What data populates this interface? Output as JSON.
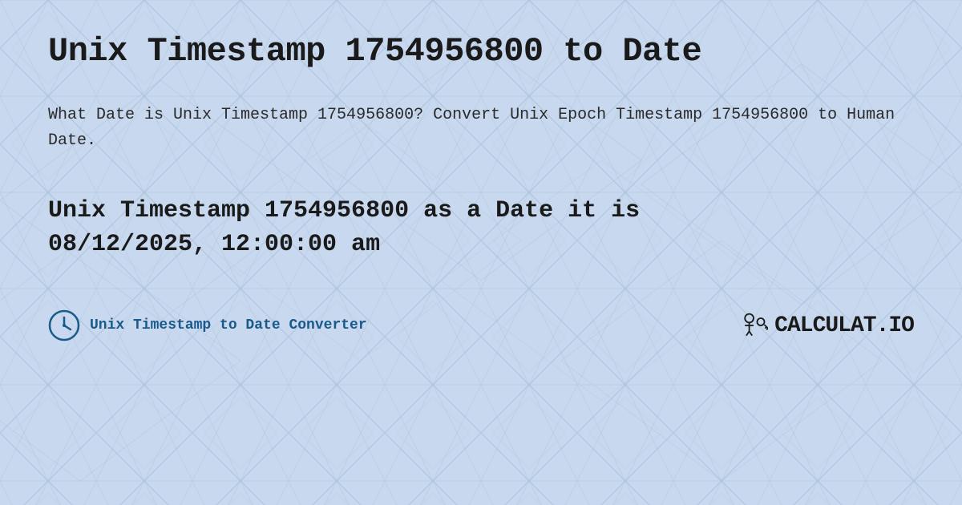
{
  "page": {
    "title": "Unix Timestamp 1754956800 to Date",
    "description": "What Date is Unix Timestamp 1754956800? Convert Unix Epoch Timestamp 1754956800 to Human Date.",
    "result_line1": "Unix Timestamp 1754956800 as a Date it is",
    "result_line2": "08/12/2025, 12:00:00 am",
    "background_color": "#c8d8ee"
  },
  "footer": {
    "link_text": "Unix Timestamp to Date Converter",
    "logo_text": "CALCULAT.IO"
  },
  "icons": {
    "clock": "clock-icon",
    "logo_icon": "key-icon"
  }
}
